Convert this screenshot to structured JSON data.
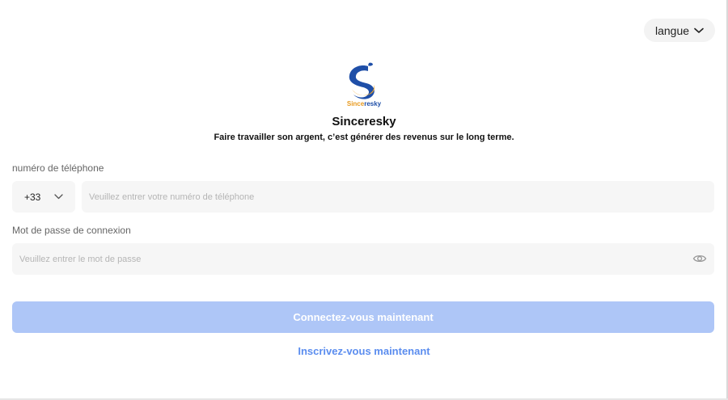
{
  "header": {
    "language_label": "langue"
  },
  "brand": {
    "logo_text": "Sinceresky",
    "app_name": "Sinceresky",
    "tagline": "Faire travailler son argent, c’est générer des revenus sur le long terme."
  },
  "form": {
    "phone_label": "numéro de téléphone",
    "country_code": "+33",
    "phone_placeholder": "Veuillez entrer votre numéro de téléphone",
    "phone_value": "",
    "password_label": "Mot de passe de connexion",
    "password_placeholder": "Veuillez entrer le mot de passe",
    "password_value": ""
  },
  "actions": {
    "login_label": "Connectez-vous maintenant",
    "register_label": "Inscrivez-vous maintenant"
  },
  "colors": {
    "primary_button": "#aec6f7",
    "link": "#5b8def",
    "logo_blue": "#1f4fa8",
    "logo_orange": "#f5a623"
  },
  "icons": {
    "language_dropdown": "chevron-down-icon",
    "country_dropdown": "chevron-down-icon",
    "password_toggle": "eye-icon"
  }
}
